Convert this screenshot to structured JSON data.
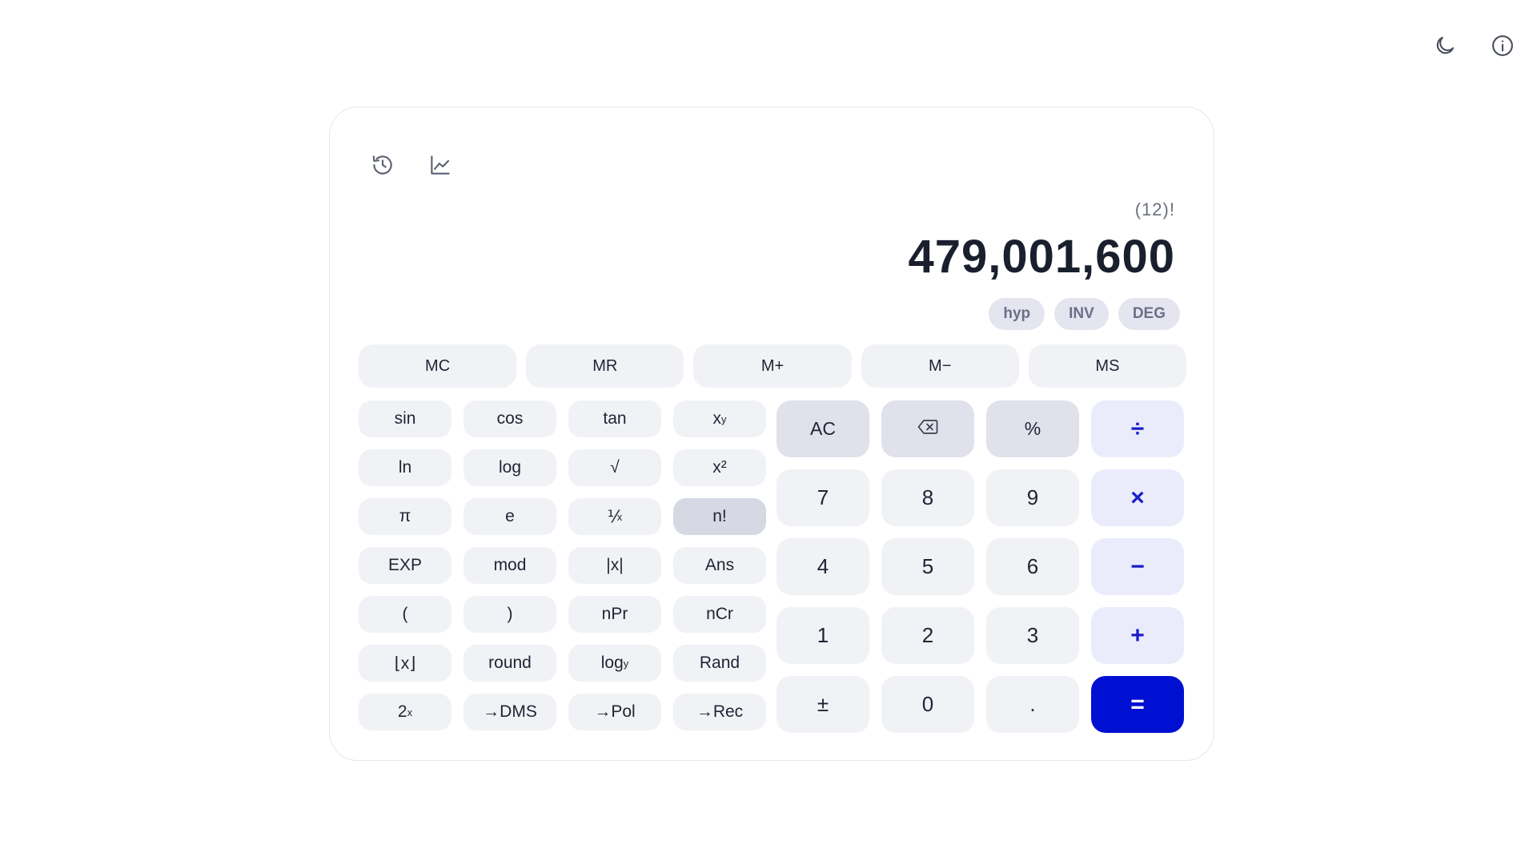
{
  "header": {
    "icons": [
      "moon-icon",
      "info-icon"
    ]
  },
  "toolbar": {
    "icons": [
      "history-icon",
      "graph-icon"
    ]
  },
  "display": {
    "expression": "(12)!",
    "result": "479,001,600"
  },
  "modes": [
    "hyp",
    "INV",
    "DEG"
  ],
  "memory": [
    "MC",
    "MR",
    "M+",
    "M−",
    "MS"
  ],
  "scientific": [
    {
      "label": "sin",
      "name": "sin-button"
    },
    {
      "label": "cos",
      "name": "cos-button"
    },
    {
      "label": "tan",
      "name": "tan-button"
    },
    {
      "label": "x",
      "sup": "y",
      "name": "power-button"
    },
    {
      "label": "ln",
      "name": "ln-button"
    },
    {
      "label": "log",
      "name": "log-button"
    },
    {
      "label": "√",
      "name": "sqrt-button"
    },
    {
      "label": "x²",
      "name": "square-button"
    },
    {
      "label": "π",
      "name": "pi-button"
    },
    {
      "label": "e",
      "name": "e-button"
    },
    {
      "label": "⅟",
      "sub": "x",
      "name": "reciprocal-button"
    },
    {
      "label": "n!",
      "name": "factorial-button",
      "active": true
    },
    {
      "label": "EXP",
      "name": "exp-button"
    },
    {
      "label": "mod",
      "name": "mod-button"
    },
    {
      "label": "|x|",
      "name": "abs-button"
    },
    {
      "label": "Ans",
      "name": "ans-button"
    },
    {
      "label": "(",
      "name": "open-paren-button"
    },
    {
      "label": ")",
      "name": "close-paren-button"
    },
    {
      "label": "nPr",
      "name": "npr-button"
    },
    {
      "label": "nCr",
      "name": "ncr-button"
    },
    {
      "label": "⌊x⌋",
      "name": "floor-button"
    },
    {
      "label": "round",
      "name": "round-button"
    },
    {
      "label": "log",
      "sub": "y",
      "name": "logy-button"
    },
    {
      "label": "Rand",
      "name": "rand-button"
    },
    {
      "label": "2",
      "sup": "x",
      "name": "two-power-button"
    },
    {
      "label": "→DMS",
      "name": "to-dms-button"
    },
    {
      "label": "→Pol",
      "name": "to-pol-button"
    },
    {
      "label": "→Rec",
      "name": "to-rec-button"
    }
  ],
  "numpad": [
    {
      "label": "AC",
      "kind": "fn",
      "name": "all-clear-button"
    },
    {
      "label": "",
      "kind": "fn",
      "icon": "backspace-icon",
      "name": "backspace-button"
    },
    {
      "label": "%",
      "kind": "fn",
      "name": "percent-button"
    },
    {
      "label": "÷",
      "kind": "op",
      "name": "divide-button"
    },
    {
      "label": "7",
      "kind": "digit",
      "name": "digit-7-button"
    },
    {
      "label": "8",
      "kind": "digit",
      "name": "digit-8-button"
    },
    {
      "label": "9",
      "kind": "digit",
      "name": "digit-9-button"
    },
    {
      "label": "×",
      "kind": "op",
      "name": "multiply-button"
    },
    {
      "label": "4",
      "kind": "digit",
      "name": "digit-4-button"
    },
    {
      "label": "5",
      "kind": "digit",
      "name": "digit-5-button"
    },
    {
      "label": "6",
      "kind": "digit",
      "name": "digit-6-button"
    },
    {
      "label": "−",
      "kind": "op",
      "name": "subtract-button"
    },
    {
      "label": "1",
      "kind": "digit",
      "name": "digit-1-button"
    },
    {
      "label": "2",
      "kind": "digit",
      "name": "digit-2-button"
    },
    {
      "label": "3",
      "kind": "digit",
      "name": "digit-3-button"
    },
    {
      "label": "+",
      "kind": "op",
      "name": "add-button"
    },
    {
      "label": "±",
      "kind": "digit",
      "name": "negate-button"
    },
    {
      "label": "0",
      "kind": "digit",
      "name": "digit-0-button"
    },
    {
      "label": ".",
      "kind": "digit",
      "name": "decimal-button"
    },
    {
      "label": "=",
      "kind": "eq",
      "name": "equals-button"
    }
  ],
  "colors": {
    "accent": "#0010d2",
    "operator_text": "#1a1ec8",
    "operator_bg": "#ebecfb",
    "key_bg": "#f1f2f6"
  }
}
